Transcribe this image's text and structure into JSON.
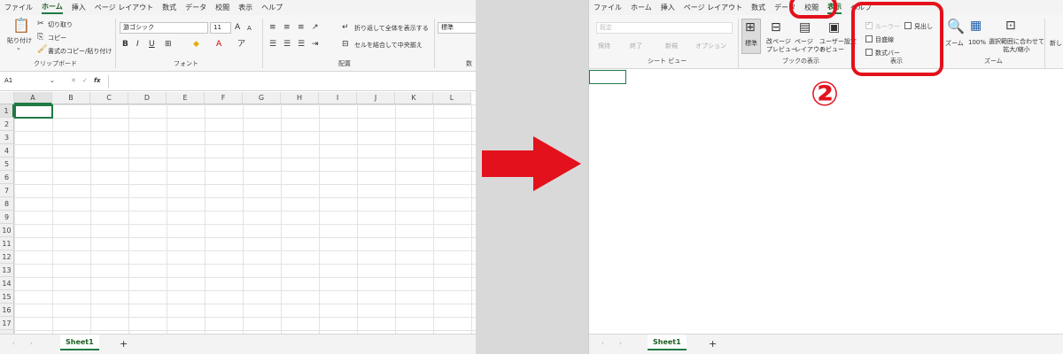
{
  "left": {
    "menu": [
      "ファイル",
      "ホーム",
      "挿入",
      "ページ レイアウト",
      "数式",
      "データ",
      "校閲",
      "表示",
      "ヘルプ"
    ],
    "menu_active": "ホーム",
    "clipboard": {
      "paste": "貼り付け",
      "cut": "切り取り",
      "copy": "コピー",
      "format_painter": "書式のコピー/貼り付け",
      "group": "クリップボード"
    },
    "font": {
      "name": "游ゴシック",
      "size": "11",
      "group": "フォント"
    },
    "alignment": {
      "wrap": "折り返して全体を表示する",
      "merge": "セルを結合して中央揃え",
      "group": "配置"
    },
    "number": {
      "format": "標準",
      "group": "数"
    },
    "namebox": "A1",
    "fx": "fx",
    "columns": [
      "A",
      "B",
      "C",
      "D",
      "E",
      "F",
      "G",
      "H",
      "I",
      "J",
      "K",
      "L"
    ],
    "rows": [
      "1",
      "2",
      "3",
      "4",
      "5",
      "6",
      "7",
      "8",
      "9",
      "10",
      "11",
      "12",
      "13",
      "14",
      "15",
      "16",
      "17",
      "18"
    ],
    "sheet": "Sheet1",
    "add_sheet": "+"
  },
  "right": {
    "menu": [
      "ファイル",
      "ホーム",
      "挿入",
      "ページ レイアウト",
      "数式",
      "データ",
      "校閲",
      "表示",
      "ヘルプ"
    ],
    "menu_active": "表示",
    "sheetview": {
      "dropdown": "既定",
      "keep": "保持",
      "exit": "終了",
      "new": "新規",
      "options": "オプション",
      "group": "シート ビュー"
    },
    "bookview": {
      "normal": "標準",
      "pagebreak": "改ページ\nプレビュー",
      "pagelayout": "ページ\nレイアウト",
      "custom": "ユーザー設定\nのビュー",
      "group": "ブックの表示"
    },
    "show": {
      "ruler": "ルーラー",
      "headings": "見出し",
      "gridlines": "目盛線",
      "formulabar": "数式バー",
      "group": "表示"
    },
    "zoom": {
      "zoom": "ズーム",
      "hundred": "100%",
      "fit": "選択範囲に合わせて\n拡大/縮小",
      "group": "ズーム",
      "new_window": "新し"
    },
    "annotation": "②",
    "sheet": "Sheet1",
    "add_sheet": "+"
  },
  "colors": {
    "accent_green": "#1f7a44",
    "highlight_red": "#e3111c",
    "arrow_red": "#e3111c"
  }
}
